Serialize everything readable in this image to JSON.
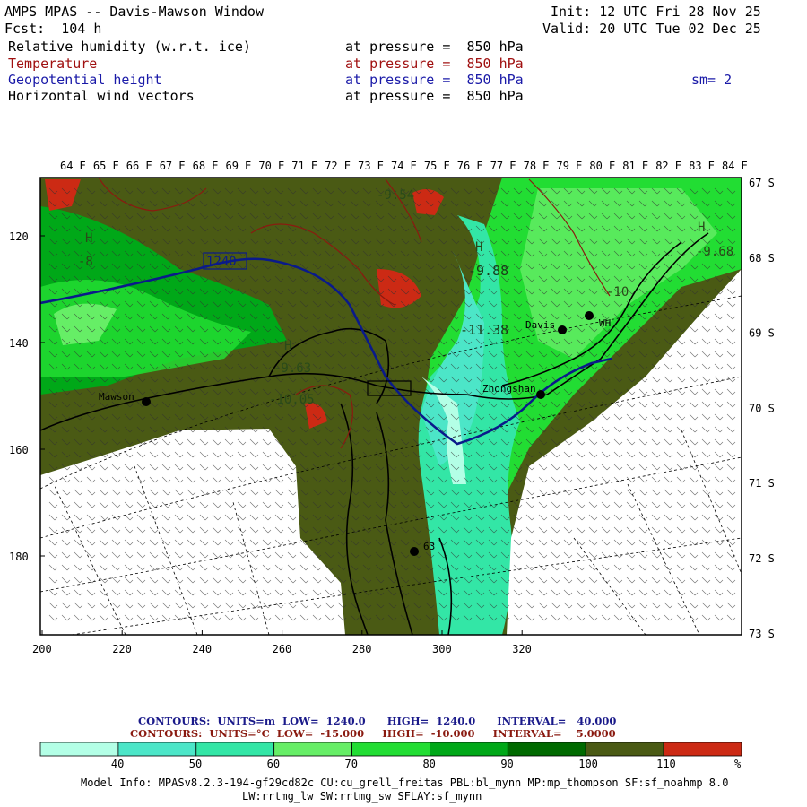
{
  "header": {
    "title": "AMPS MPAS -- Davis-Mawson Window",
    "fcst_label": "Fcst:",
    "fcst_value": "104 h",
    "init_label": "Init:",
    "init_value": "12 UTC Fri 28 Nov 25",
    "valid_label": "Valid:",
    "valid_value": "20 UTC Tue 02 Dec 25",
    "fields": [
      {
        "name": "Relative humidity (w.r.t. ice)",
        "level": "at pressure =  850 hPa",
        "color": "#000000"
      },
      {
        "name": "Temperature",
        "level": "at pressure =  850 hPa",
        "color": "#a01010"
      },
      {
        "name": "Geopotential height",
        "level": "at pressure =  850 hPa",
        "color": "#1a1aa8"
      },
      {
        "name": "Horizontal wind vectors",
        "level": "at pressure =  850 hPa",
        "color": "#000000"
      }
    ],
    "smoothing": "sm= 2"
  },
  "map": {
    "lon_labels": [
      "64 E",
      "65 E",
      "66 E",
      "67 E",
      "68 E",
      "69 E",
      "70 E",
      "71 E",
      "72 E",
      "73 E",
      "74 E",
      "75 E",
      "76 E",
      "77 E",
      "78 E",
      "79 E",
      "80 E",
      "81 E",
      "82 E",
      "83 E",
      "84 E"
    ],
    "lat_labels": [
      "67 S",
      "68 S",
      "69 S",
      "70 S",
      "71 S",
      "72 S",
      "73 S"
    ],
    "x_ticks": [
      "200",
      "220",
      "240",
      "260",
      "280",
      "300",
      "320"
    ],
    "y_ticks": [
      "120",
      "140",
      "160",
      "180"
    ],
    "stations": [
      {
        "name": "Mawson"
      },
      {
        "name": "Davis"
      },
      {
        "name": "Zhongshan"
      },
      {
        "name": "WH"
      },
      {
        "name": "63"
      }
    ],
    "height_label": "1240",
    "contour_values": [
      "-9.88",
      "-11.38",
      "-9.63",
      "-10.05",
      "-8",
      "-10",
      "-9.54",
      "-9.68"
    ],
    "high_markers": [
      "H",
      "H",
      "H",
      "H"
    ]
  },
  "legend": {
    "contour_line1": "CONTOURS:  UNITS=m  LOW=  1240.0      HIGH=  1240.0      INTERVAL=   40.000",
    "contour_line2": "CONTOURS:  UNITS=°C  LOW=  -15.000     HIGH=  -10.000     INTERVAL=    5.0000",
    "ticks": [
      "40",
      "50",
      "60",
      "70",
      "80",
      "90",
      "100",
      "110",
      "%"
    ],
    "colors": [
      "#b3ffe6",
      "#4ce6c8",
      "#33e6a6",
      "#66ee66",
      "#22dd33",
      "#00a818",
      "#006a00",
      "#4a5a14",
      "#cc2a14"
    ]
  },
  "model_info": {
    "line1": "Model Info: MPASv8.2.3-194-gf29cd82c CU:cu_grell_freitas PBL:bl_mynn MP:mp_thompson SF:sf_noahmp 8.0",
    "line2": "LW:rrtmg_lw SW:rrtmg_sw SFLAY:sf_mynn"
  }
}
